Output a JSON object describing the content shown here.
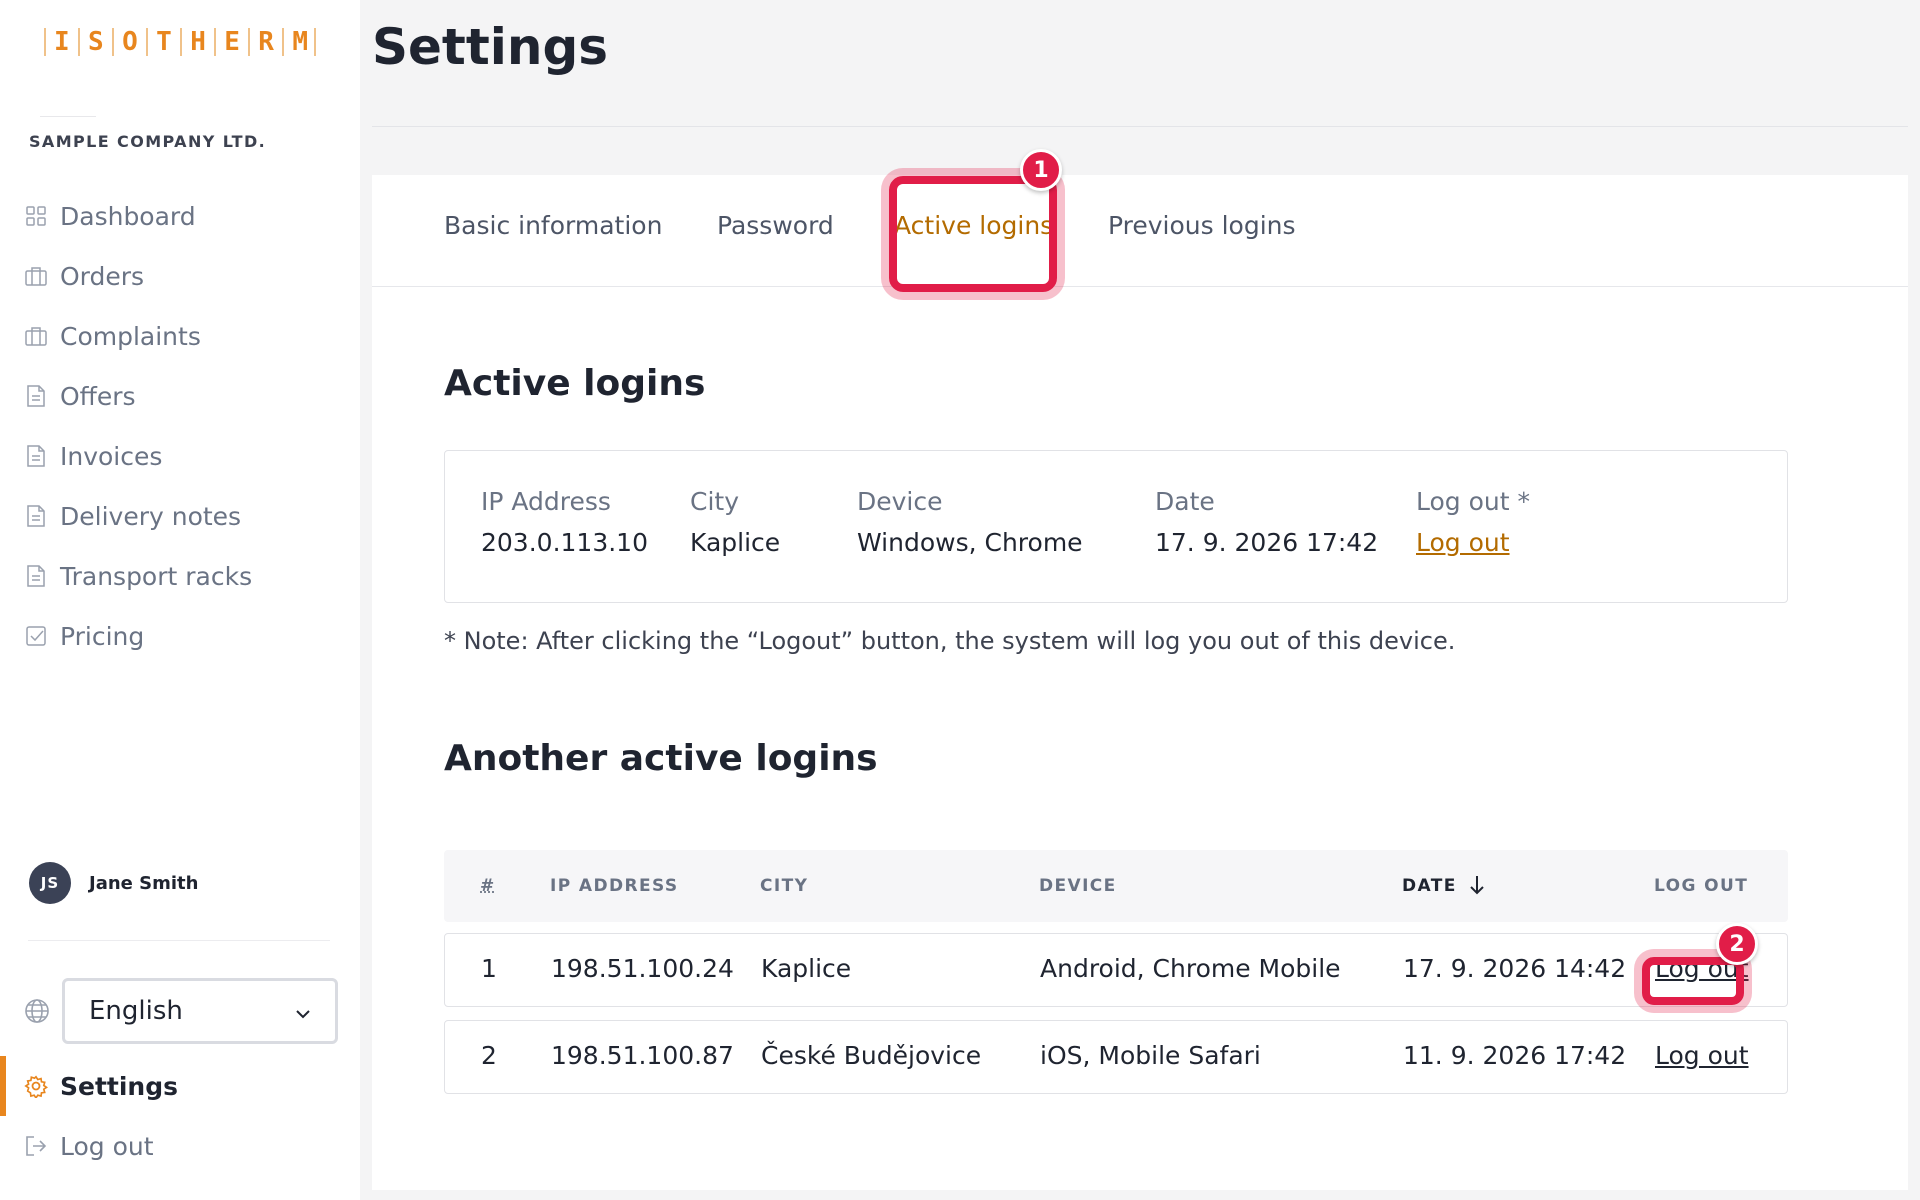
{
  "brand": {
    "logo_letters": [
      "I",
      "S",
      "O",
      "T",
      "H",
      "E",
      "R",
      "M"
    ],
    "accent_color": "#e8861e",
    "link_color": "#b36b00",
    "highlight_color": "#e11d48"
  },
  "sidebar": {
    "company": "SAMPLE COMPANY LTD.",
    "items": [
      {
        "label": "Dashboard",
        "icon": "grid-icon"
      },
      {
        "label": "Orders",
        "icon": "briefcase-icon"
      },
      {
        "label": "Complaints",
        "icon": "briefcase-icon"
      },
      {
        "label": "Offers",
        "icon": "document-icon"
      },
      {
        "label": "Invoices",
        "icon": "document-icon"
      },
      {
        "label": "Delivery notes",
        "icon": "document-icon"
      },
      {
        "label": "Transport racks",
        "icon": "document-icon"
      },
      {
        "label": "Pricing",
        "icon": "checkbox-icon"
      }
    ],
    "user": {
      "initials": "JS",
      "name": "Jane Smith"
    },
    "language": {
      "selected": "English"
    },
    "settings_label": "Settings",
    "logout_label": "Log out"
  },
  "page": {
    "title": "Settings"
  },
  "tabs": [
    {
      "label": "Basic information",
      "active": false
    },
    {
      "label": "Password",
      "active": false
    },
    {
      "label": "Active logins",
      "active": true
    },
    {
      "label": "Previous logins",
      "active": false
    }
  ],
  "current": {
    "title": "Active logins",
    "columns": {
      "ip": "IP Address",
      "city": "City",
      "device": "Device",
      "date": "Date",
      "logout": "Log out *"
    },
    "row": {
      "ip": "203.0.113.10",
      "city": "Kaplice",
      "device": "Windows, Chrome",
      "date": "17. 9. 2026 17:42",
      "logout": "Log out"
    },
    "note": "* Note: After clicking the “Logout” button, the system will log you out of this device."
  },
  "others": {
    "title": "Another active logins",
    "headers": {
      "num": "#",
      "ip": "IP ADDRESS",
      "city": "CITY",
      "device": "DEVICE",
      "date": "DATE",
      "logout": "LOG OUT"
    },
    "rows": [
      {
        "num": "1",
        "ip": "198.51.100.24",
        "city": "Kaplice",
        "device": "Android, Chrome Mobile",
        "date": "17. 9. 2026 14:42",
        "logout": "Log out"
      },
      {
        "num": "2",
        "ip": "198.51.100.87",
        "city": "České Budějovice",
        "device": "iOS, Mobile Safari",
        "date": "11. 9. 2026 17:42",
        "logout": "Log out"
      }
    ]
  },
  "annotations": [
    {
      "number": "1",
      "target": "Active logins tab"
    },
    {
      "number": "2",
      "target": "Log out (row 1)"
    }
  ]
}
